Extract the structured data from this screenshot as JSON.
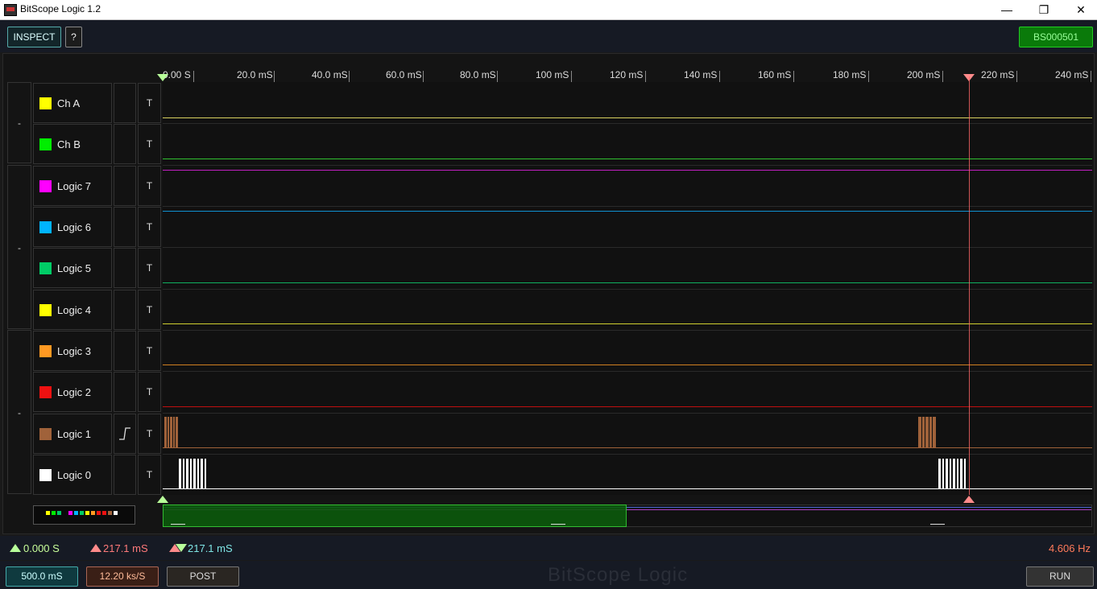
{
  "window": {
    "title": "BitScope Logic 1.2",
    "minimize": "—",
    "maximize": "❐",
    "close": "✕"
  },
  "toolbar": {
    "inspect": "INSPECT",
    "help": "?",
    "device": "BS000501"
  },
  "ruler": {
    "labels": [
      "0.00  S",
      "20.0 mS",
      "40.0 mS",
      "60.0 mS",
      "80.0 mS",
      "100 mS",
      "120 mS",
      "140 mS",
      "160 mS",
      "180 mS",
      "200 mS",
      "220 mS",
      "240 mS"
    ]
  },
  "groups": [
    "-",
    "-",
    "-"
  ],
  "channels": [
    {
      "name": "Ch A",
      "color": "#ffff00",
      "trigger": "T"
    },
    {
      "name": "Ch B",
      "color": "#00ee00",
      "trigger": "T"
    },
    {
      "name": "Logic 7",
      "color": "#ff00ff",
      "trigger": "T"
    },
    {
      "name": "Logic 6",
      "color": "#00b4ff",
      "trigger": "T"
    },
    {
      "name": "Logic 5",
      "color": "#00cc66",
      "trigger": "T"
    },
    {
      "name": "Logic 4",
      "color": "#ffff00",
      "trigger": "T"
    },
    {
      "name": "Logic 3",
      "color": "#ff9922",
      "trigger": "T"
    },
    {
      "name": "Logic 2",
      "color": "#ee1111",
      "trigger": "T"
    },
    {
      "name": "Logic 1",
      "color": "#a0623a",
      "trigger": "T",
      "edge": "rising-edge-icon"
    },
    {
      "name": "Logic 0",
      "color": "#ffffff",
      "trigger": "T"
    }
  ],
  "status": {
    "cursor_a": "0.000  S",
    "cursor_b": "217.1 mS",
    "delta": "217.1 mS",
    "frequency": "4.606  Hz"
  },
  "bottom": {
    "timebase": "500.0 mS",
    "sample_rate": "12.20 ks/S",
    "post": "POST",
    "run": "RUN",
    "watermark": "BitScope Logic"
  }
}
